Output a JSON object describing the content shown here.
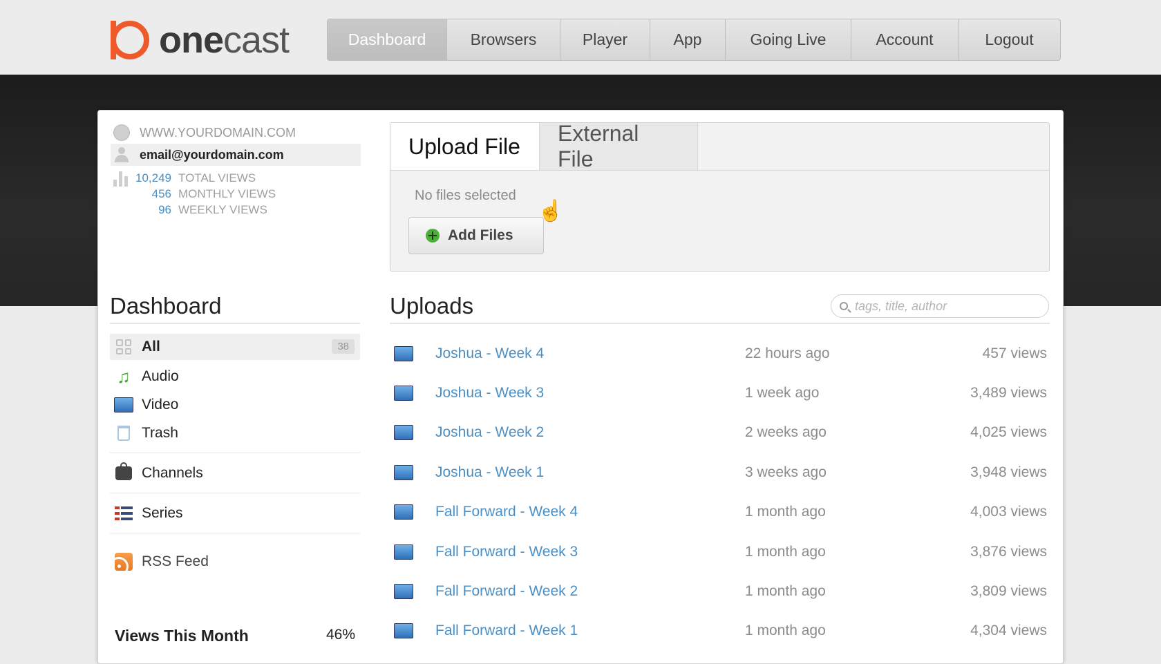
{
  "brand": {
    "logo_bold": "one",
    "logo_light": "cast"
  },
  "nav": [
    {
      "label": "Dashboard",
      "active": true
    },
    {
      "label": "Browsers"
    },
    {
      "label": "Player"
    },
    {
      "label": "App"
    },
    {
      "label": "Going Live"
    },
    {
      "label": "Account"
    },
    {
      "label": "Logout"
    }
  ],
  "account": {
    "domain": "WWW.YOURDOMAIN.COM",
    "email": "email@yourdomain.com",
    "stats": [
      {
        "value": "10,249",
        "label": "TOTAL VIEWS"
      },
      {
        "value": "456",
        "label": "MONTHLY VIEWS"
      },
      {
        "value": "96",
        "label": "WEEKLY VIEWS"
      }
    ]
  },
  "sidebar": {
    "title": "Dashboard",
    "items": [
      {
        "label": "All",
        "count": "38",
        "icon": "grid-icon",
        "active": true
      },
      {
        "label": "Audio",
        "icon": "music-note-icon"
      },
      {
        "label": "Video",
        "icon": "video-icon"
      },
      {
        "label": "Trash",
        "icon": "trash-icon"
      },
      {
        "label": "Channels",
        "icon": "tv-icon"
      },
      {
        "label": "Series",
        "icon": "list-icon"
      },
      {
        "label": "RSS Feed",
        "icon": "rss-icon"
      }
    ],
    "views_this_month": {
      "label": "Views This Month",
      "value": "46%"
    }
  },
  "upload": {
    "tabs": [
      {
        "label": "Upload File",
        "active": true
      },
      {
        "label": "External File"
      }
    ],
    "status": "No files selected",
    "add_button": "Add Files"
  },
  "uploads": {
    "title": "Uploads",
    "search_placeholder": "tags, title, author",
    "rows": [
      {
        "name": "Joshua - Week 4",
        "time": "22 hours ago",
        "views": "457 views"
      },
      {
        "name": "Joshua - Week 3",
        "time": "1 week ago",
        "views": "3,489 views"
      },
      {
        "name": "Joshua - Week 2",
        "time": "2 weeks ago",
        "views": "4,025 views"
      },
      {
        "name": "Joshua - Week 1",
        "time": "3 weeks ago",
        "views": "3,948 views"
      },
      {
        "name": "Fall Forward - Week 4",
        "time": "1 month ago",
        "views": "4,003 views"
      },
      {
        "name": "Fall Forward - Week 3",
        "time": "1 month ago",
        "views": "3,876 views"
      },
      {
        "name": "Fall Forward - Week 2",
        "time": "1 month ago",
        "views": "3,809 views"
      },
      {
        "name": "Fall Forward - Week 1",
        "time": "1 month ago",
        "views": "4,304 views"
      }
    ]
  },
  "colors": {
    "accent": "#ee5a2a",
    "link": "#4b8fc4"
  }
}
